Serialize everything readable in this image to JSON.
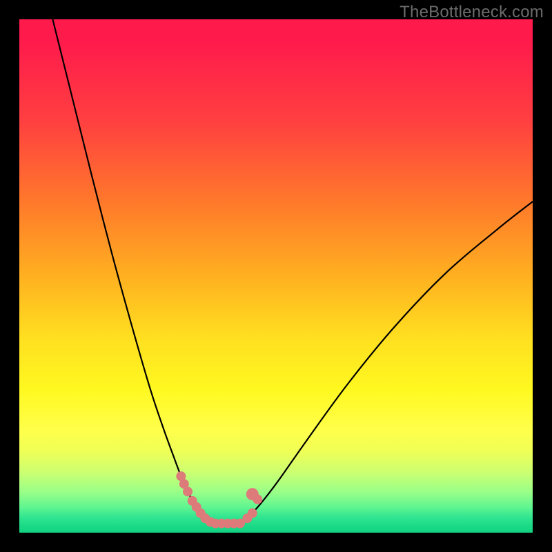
{
  "watermark": {
    "text": "TheBottleneck.com"
  },
  "chart_data": {
    "type": "line",
    "title": "",
    "xlabel": "",
    "ylabel": "",
    "xlim": [
      0,
      1
    ],
    "ylim": [
      0,
      1
    ],
    "series": [
      {
        "name": "left-curve",
        "x": [
          0.065,
          0.1,
          0.14,
          0.18,
          0.22,
          0.255,
          0.28,
          0.3,
          0.315,
          0.328,
          0.345,
          0.36,
          0.38
        ],
        "y": [
          1.0,
          0.86,
          0.7,
          0.545,
          0.4,
          0.28,
          0.205,
          0.15,
          0.11,
          0.08,
          0.05,
          0.03,
          0.018
        ]
      },
      {
        "name": "right-curve",
        "x": [
          0.43,
          0.46,
          0.5,
          0.56,
          0.64,
          0.73,
          0.83,
          0.93,
          1.0
        ],
        "y": [
          0.018,
          0.045,
          0.095,
          0.18,
          0.29,
          0.4,
          0.505,
          0.59,
          0.645
        ]
      },
      {
        "name": "bottom-flat",
        "x": [
          0.38,
          0.43
        ],
        "y": [
          0.018,
          0.018
        ]
      }
    ],
    "markers": {
      "name": "pink-dots",
      "color": "#dd7a7a",
      "points": [
        {
          "x": 0.315,
          "y": 0.11,
          "r": 7
        },
        {
          "x": 0.321,
          "y": 0.095,
          "r": 7
        },
        {
          "x": 0.328,
          "y": 0.08,
          "r": 7
        },
        {
          "x": 0.337,
          "y": 0.062,
          "r": 7
        },
        {
          "x": 0.345,
          "y": 0.05,
          "r": 7
        },
        {
          "x": 0.353,
          "y": 0.038,
          "r": 7
        },
        {
          "x": 0.362,
          "y": 0.028,
          "r": 7
        },
        {
          "x": 0.372,
          "y": 0.021,
          "r": 7
        },
        {
          "x": 0.382,
          "y": 0.018,
          "r": 7
        },
        {
          "x": 0.394,
          "y": 0.018,
          "r": 7
        },
        {
          "x": 0.406,
          "y": 0.018,
          "r": 7
        },
        {
          "x": 0.418,
          "y": 0.018,
          "r": 7
        },
        {
          "x": 0.43,
          "y": 0.018,
          "r": 7
        },
        {
          "x": 0.444,
          "y": 0.028,
          "r": 7
        },
        {
          "x": 0.454,
          "y": 0.038,
          "r": 7
        },
        {
          "x": 0.454,
          "y": 0.075,
          "r": 9
        },
        {
          "x": 0.464,
          "y": 0.065,
          "r": 7
        }
      ]
    }
  }
}
